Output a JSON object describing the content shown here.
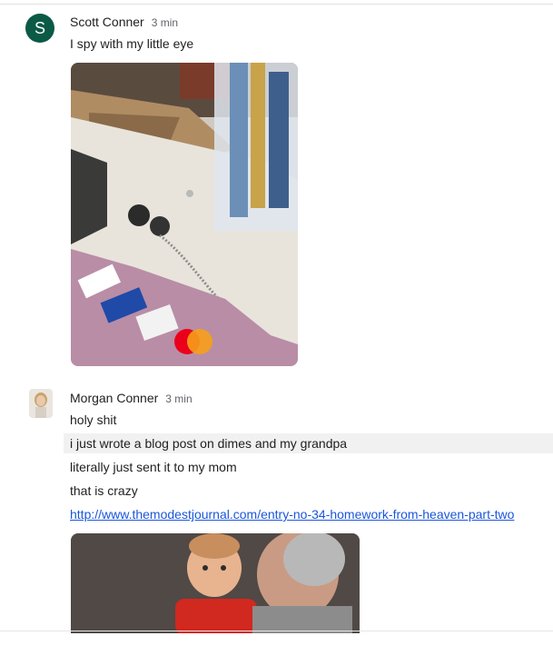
{
  "messages": [
    {
      "sender": "Scott Conner",
      "time": "3 min",
      "avatar_letter": "S",
      "lines": [
        "I spy with my little eye"
      ]
    },
    {
      "sender": "Morgan Conner",
      "time": "3 min",
      "lines": [
        "holy shit",
        "i just wrote a blog post on dimes and my grandpa",
        "literally just sent it to my mom",
        "that is crazy"
      ],
      "link": "http://www.themodestjournal.com/entry-no-34-homework-from-heaven-part-two"
    }
  ],
  "colors": {
    "avatar_s": "#0b5a45",
    "link": "#1a56db",
    "hover_row": "#f1f1f1"
  }
}
